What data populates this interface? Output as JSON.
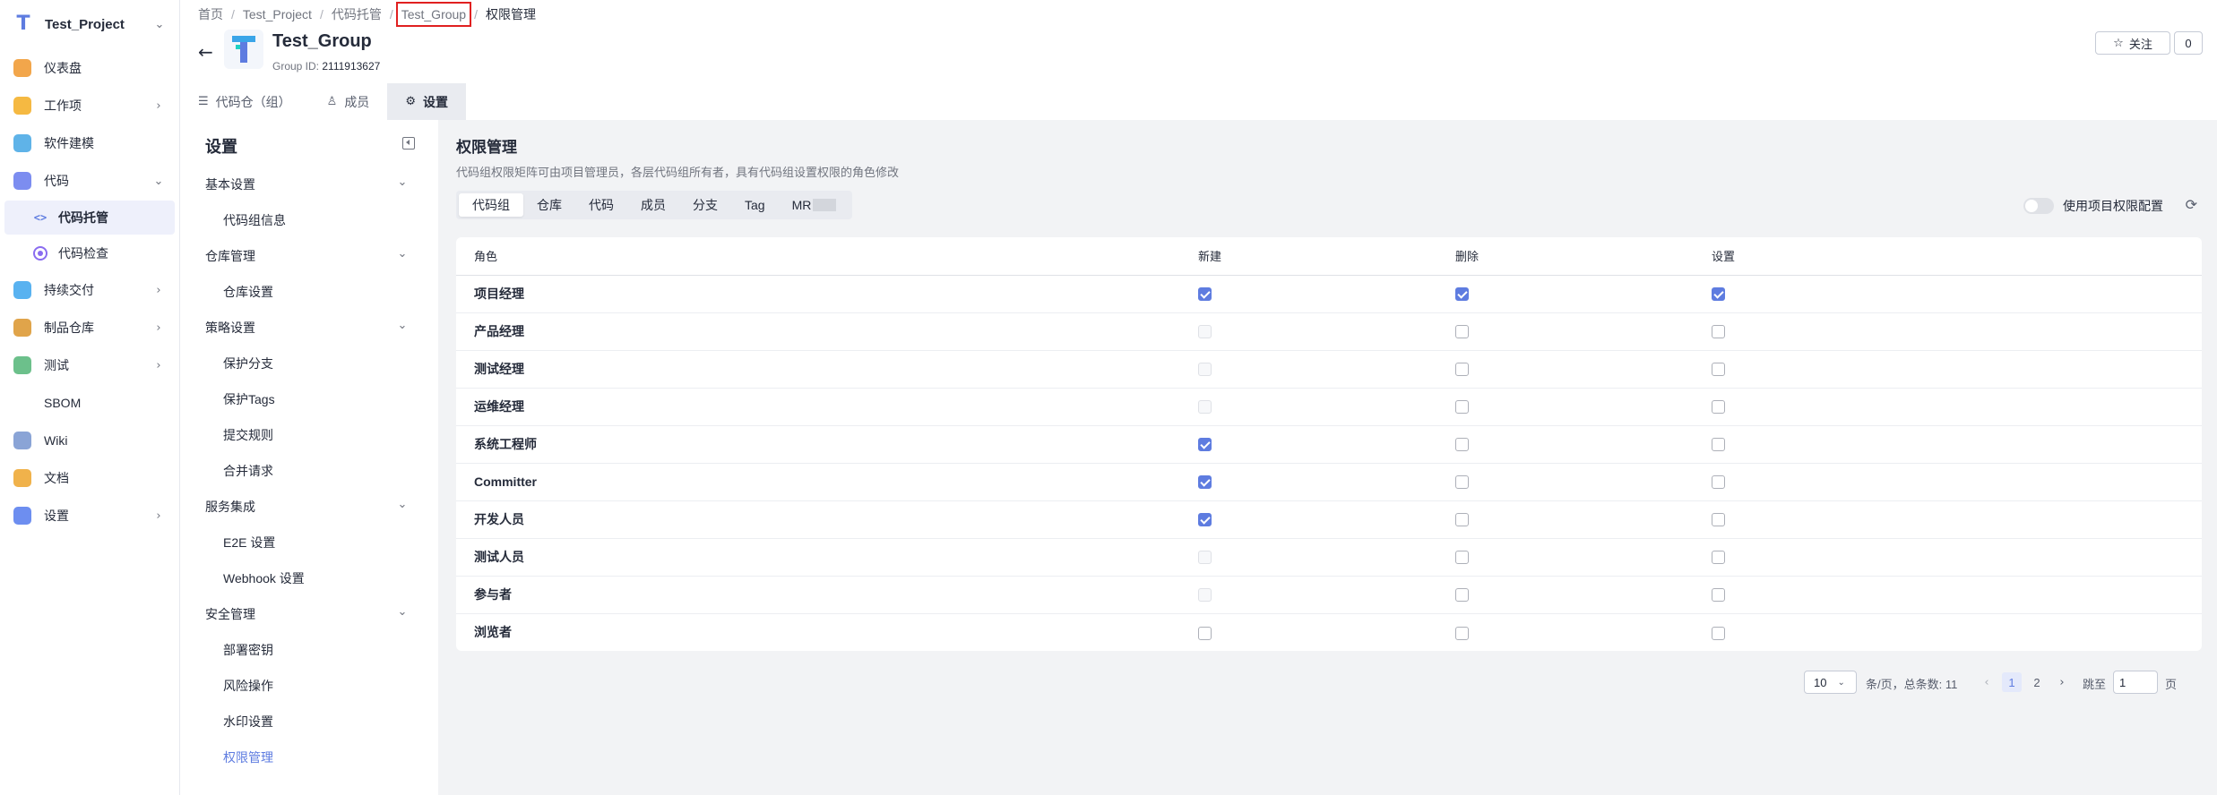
{
  "project": {
    "name": "Test_Project"
  },
  "nav": [
    {
      "label": "仪表盘",
      "icon": "dashboard-icon",
      "color": "#f2a64b",
      "chevron": ""
    },
    {
      "label": "工作项",
      "icon": "workitem-icon",
      "color": "#f5b942",
      "chevron": "›"
    },
    {
      "label": "软件建模",
      "icon": "modeling-icon",
      "color": "#5fb3e8",
      "chevron": ""
    },
    {
      "label": "代码",
      "icon": "code-icon",
      "color": "#7c8df0",
      "chevron": "⌄"
    },
    {
      "label": "代码托管",
      "icon": "code-hosting-icon",
      "sub": true,
      "active": true
    },
    {
      "label": "代码检查",
      "icon": "code-check-icon",
      "sub": true,
      "active": false
    },
    {
      "label": "持续交付",
      "icon": "delivery-icon",
      "color": "#59b2f0",
      "chevron": "›"
    },
    {
      "label": "制品仓库",
      "icon": "artifact-icon",
      "color": "#e0a44a",
      "chevron": "›"
    },
    {
      "label": "测试",
      "icon": "test-icon",
      "color": "#6cc08b",
      "chevron": "›"
    },
    {
      "label": "SBOM",
      "icon": "",
      "color": "",
      "chevron": ""
    },
    {
      "label": "Wiki",
      "icon": "wiki-icon",
      "color": "#8aa4d6",
      "chevron": ""
    },
    {
      "label": "文档",
      "icon": "docs-icon",
      "color": "#f0b24b",
      "chevron": ""
    },
    {
      "label": "设置",
      "icon": "settings-icon",
      "color": "#6d8ef0",
      "chevron": "›"
    }
  ],
  "breadcrumb": [
    "首页",
    "Test_Project",
    "代码托管",
    "Test_Group",
    "权限管理"
  ],
  "group": {
    "title": "Test_Group",
    "id_label": "Group ID:",
    "id_value": "2111913627"
  },
  "follow": {
    "label": "关注",
    "count": "0"
  },
  "tabs": [
    {
      "label": "代码仓（组）",
      "icon": "☰",
      "active": false
    },
    {
      "label": "成员",
      "icon": "♙",
      "active": false
    },
    {
      "label": "设置",
      "icon": "⚙",
      "active": true
    }
  ],
  "settings": {
    "title": "设置",
    "groups": [
      {
        "label": "基本设置",
        "items": [
          "代码组信息"
        ]
      },
      {
        "label": "仓库管理",
        "items": [
          "仓库设置"
        ]
      },
      {
        "label": "策略设置",
        "items": [
          "保护分支",
          "保护Tags",
          "提交规则",
          "合并请求"
        ]
      },
      {
        "label": "服务集成",
        "items": [
          "E2E 设置",
          "Webhook 设置"
        ]
      },
      {
        "label": "安全管理",
        "items": [
          "部署密钥",
          "风险操作",
          "水印设置",
          "权限管理"
        ]
      }
    ],
    "active_item": "权限管理"
  },
  "permissions": {
    "title": "权限管理",
    "desc": "代码组权限矩阵可由项目管理员，各层代码组所有者，具有代码组设置权限的角色修改",
    "tabs": [
      "代码组",
      "仓库",
      "代码",
      "成员",
      "分支",
      "Tag",
      "MR"
    ],
    "active_tab": "代码组",
    "toggle_label": "使用项目权限配置",
    "columns": [
      "角色",
      "新建",
      "删除",
      "设置"
    ],
    "rows": [
      {
        "role": "项目经理",
        "create": "on",
        "delete": "on",
        "settings": "on"
      },
      {
        "role": "产品经理",
        "create": "dis",
        "delete": "off",
        "settings": "off"
      },
      {
        "role": "测试经理",
        "create": "dis",
        "delete": "off",
        "settings": "off"
      },
      {
        "role": "运维经理",
        "create": "dis",
        "delete": "off",
        "settings": "off"
      },
      {
        "role": "系统工程师",
        "create": "on",
        "delete": "off",
        "settings": "off"
      },
      {
        "role": "Committer",
        "create": "on",
        "delete": "off",
        "settings": "off"
      },
      {
        "role": "开发人员",
        "create": "on",
        "delete": "off",
        "settings": "off"
      },
      {
        "role": "测试人员",
        "create": "dis",
        "delete": "off",
        "settings": "off"
      },
      {
        "role": "参与者",
        "create": "dis",
        "delete": "off",
        "settings": "off"
      },
      {
        "role": "浏览者",
        "create": "off",
        "delete": "off",
        "settings": "off"
      }
    ]
  },
  "pagination": {
    "page_size": "10",
    "summary": "条/页，总条数: 11",
    "pages": [
      "1",
      "2"
    ],
    "current": "1",
    "jump_label": "跳至",
    "jump_value": "1",
    "page_suffix": "页"
  },
  "colors": {
    "accent": "#5e7ce0",
    "highlight_box": "#e02020"
  }
}
